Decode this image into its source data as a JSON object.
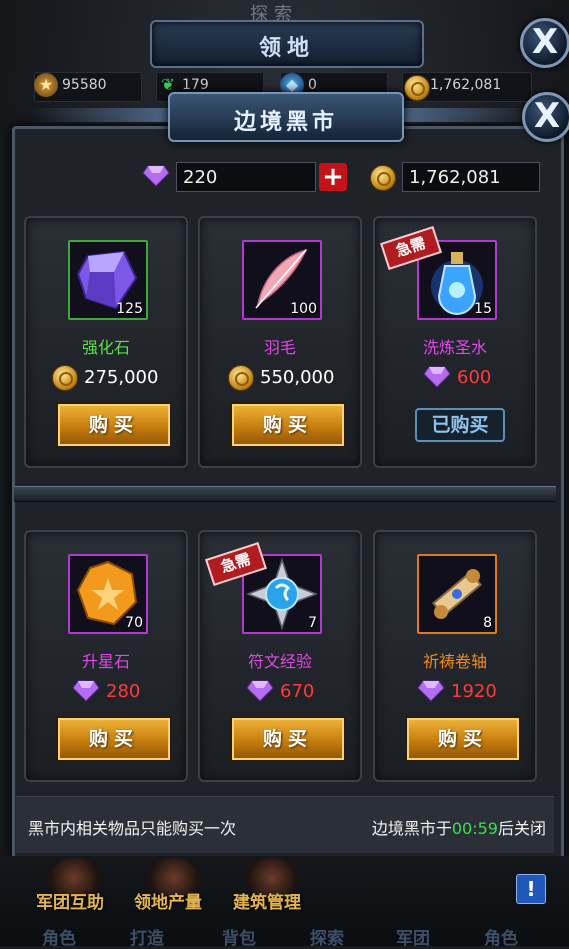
{
  "outer": {
    "ghost_title": "探索",
    "title": "领地",
    "close_label": "X"
  },
  "resources": [
    {
      "icon": "star-icon",
      "value": "95580"
    },
    {
      "icon": "green-leaf-icon",
      "value": "179"
    },
    {
      "icon": "blue-crystal-icon",
      "value": "0"
    },
    {
      "icon": "gold-coin-icon",
      "value": "1,762,081"
    }
  ],
  "market": {
    "title": "边境黑市",
    "close_label": "X",
    "gems": "220",
    "plus_label": "+",
    "gold": "1,762,081"
  },
  "items": [
    {
      "name": "强化石",
      "count": "125",
      "currency": "gold",
      "price": "275,000",
      "action": "购买",
      "urgent": false,
      "name_color": "#5be04a",
      "frame_color": "#3fa83a",
      "price_color": "#ffffff",
      "icon": "purple-gem-icon"
    },
    {
      "name": "羽毛",
      "count": "100",
      "currency": "gold",
      "price": "550,000",
      "action": "购买",
      "urgent": false,
      "name_color": "#e247e8",
      "frame_color": "#b23ad0",
      "price_color": "#ffffff",
      "icon": "feather-icon"
    },
    {
      "name": "洗炼圣水",
      "count": "15",
      "currency": "gem",
      "price": "600",
      "action": "已购买",
      "urgent": true,
      "name_color": "#e247e8",
      "frame_color": "#b23ad0",
      "price_color": "#ff3a3a",
      "icon": "holy-water-icon"
    },
    {
      "name": "升星石",
      "count": "70",
      "currency": "gem",
      "price": "280",
      "action": "购买",
      "urgent": false,
      "name_color": "#e247e8",
      "frame_color": "#b23ad0",
      "price_color": "#ff3a3a",
      "icon": "amber-star-stone-icon"
    },
    {
      "name": "符文经验",
      "count": "7",
      "currency": "gem",
      "price": "670",
      "action": "购买",
      "urgent": true,
      "name_color": "#e247e8",
      "frame_color": "#b23ad0",
      "price_color": "#ff3a3a",
      "icon": "rune-icon"
    },
    {
      "name": "祈祷卷轴",
      "count": "8",
      "currency": "gem",
      "price": "1920",
      "action": "购买",
      "urgent": false,
      "name_color": "#f08a1c",
      "frame_color": "#e07a1a",
      "price_color": "#ff3a3a",
      "icon": "scroll-icon"
    }
  ],
  "urgent_label": "急需",
  "footer": {
    "notice": "黑市内相关物品只能购买一次",
    "close_prefix": "边境黑市于",
    "timer": "00:59",
    "close_suffix": "后关闭"
  },
  "bottom_nav": {
    "items": [
      "军团互助",
      "领地产量",
      "建筑管理"
    ],
    "ghost_tabs": [
      "角色",
      "打造",
      "背包",
      "探索",
      "军团",
      "角色"
    ],
    "info_label": "!"
  }
}
